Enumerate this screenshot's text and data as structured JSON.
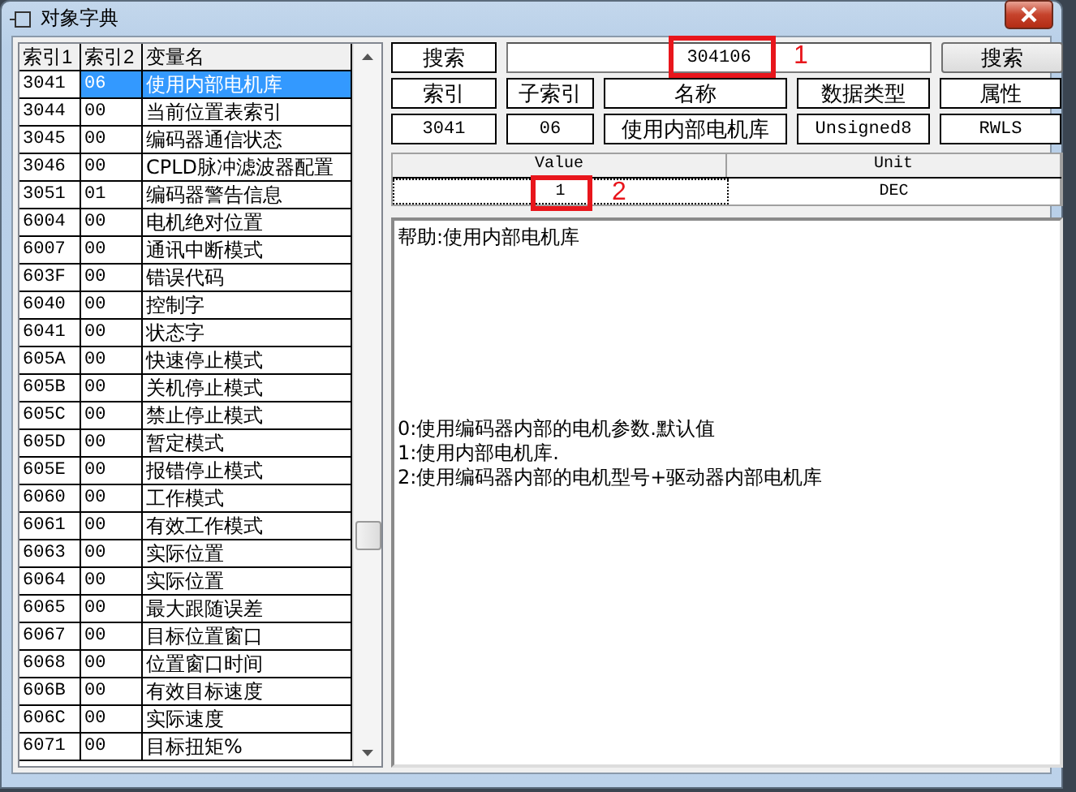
{
  "window": {
    "title": "对象字典"
  },
  "list": {
    "columns": [
      "索引1",
      "索引2",
      "变量名"
    ],
    "rows": [
      {
        "index": "3041",
        "subindex": "06",
        "name": "使用内部电机库",
        "selected": true
      },
      {
        "index": "3044",
        "subindex": "00",
        "name": "当前位置表索引",
        "selected": false
      },
      {
        "index": "3045",
        "subindex": "00",
        "name": "编码器通信状态",
        "selected": false
      },
      {
        "index": "3046",
        "subindex": "00",
        "name": "CPLD脉冲滤波器配置",
        "selected": false
      },
      {
        "index": "3051",
        "subindex": "01",
        "name": "编码器警告信息",
        "selected": false
      },
      {
        "index": "6004",
        "subindex": "00",
        "name": "电机绝对位置",
        "selected": false
      },
      {
        "index": "6007",
        "subindex": "00",
        "name": "通讯中断模式",
        "selected": false
      },
      {
        "index": "603F",
        "subindex": "00",
        "name": "错误代码",
        "selected": false
      },
      {
        "index": "6040",
        "subindex": "00",
        "name": "控制字",
        "selected": false
      },
      {
        "index": "6041",
        "subindex": "00",
        "name": "状态字",
        "selected": false
      },
      {
        "index": "605A",
        "subindex": "00",
        "name": "快速停止模式",
        "selected": false
      },
      {
        "index": "605B",
        "subindex": "00",
        "name": "关机停止模式",
        "selected": false
      },
      {
        "index": "605C",
        "subindex": "00",
        "name": "禁止停止模式",
        "selected": false
      },
      {
        "index": "605D",
        "subindex": "00",
        "name": "暂定模式",
        "selected": false
      },
      {
        "index": "605E",
        "subindex": "00",
        "name": "报错停止模式",
        "selected": false
      },
      {
        "index": "6060",
        "subindex": "00",
        "name": "工作模式",
        "selected": false
      },
      {
        "index": "6061",
        "subindex": "00",
        "name": "有效工作模式",
        "selected": false
      },
      {
        "index": "6063",
        "subindex": "00",
        "name": "实际位置",
        "selected": false
      },
      {
        "index": "6064",
        "subindex": "00",
        "name": "实际位置",
        "selected": false
      },
      {
        "index": "6065",
        "subindex": "00",
        "name": "最大跟随误差",
        "selected": false
      },
      {
        "index": "6067",
        "subindex": "00",
        "name": "目标位置窗口",
        "selected": false
      },
      {
        "index": "6068",
        "subindex": "00",
        "name": "位置窗口时间",
        "selected": false
      },
      {
        "index": "606B",
        "subindex": "00",
        "name": "有效目标速度",
        "selected": false
      },
      {
        "index": "606C",
        "subindex": "00",
        "name": "实际速度",
        "selected": false
      },
      {
        "index": "6071",
        "subindex": "00",
        "name": "目标扭矩%",
        "selected": false
      }
    ]
  },
  "search": {
    "label": "搜索",
    "value": "304106",
    "button": "搜索"
  },
  "details": {
    "headers": [
      "索引",
      "子索引",
      "名称",
      "数据类型",
      "属性"
    ],
    "values": [
      "3041",
      "06",
      "使用内部电机库",
      "Unsigned8",
      "RWLS"
    ]
  },
  "value_table": {
    "columns": [
      "Value",
      "Unit"
    ],
    "values": [
      "1",
      "DEC"
    ]
  },
  "help": {
    "title": "帮助:使用内部电机库",
    "options": [
      "0:使用编码器内部的电机参数.默认值",
      "1:使用内部电机库.",
      "2:使用编码器内部的电机型号+驱动器内部电机库"
    ]
  },
  "annotations": [
    "1",
    "2"
  ]
}
